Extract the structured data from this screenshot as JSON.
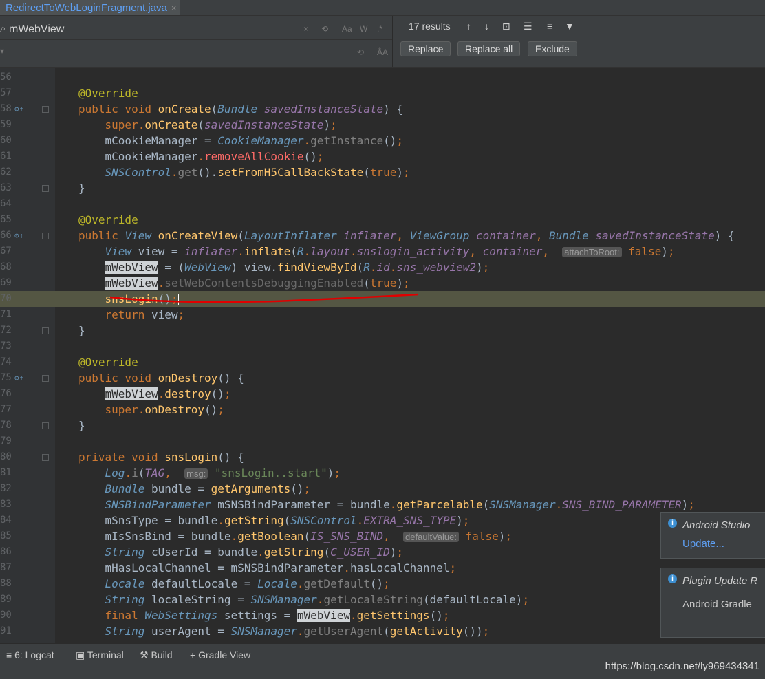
{
  "tab": {
    "label": "RedirectToWebLoginFragment.java",
    "close": "×"
  },
  "find": {
    "search_value": "mWebView",
    "options": [
      "×",
      "⟲",
      "Aa",
      "W",
      ".*"
    ],
    "replace_options": [
      "⟲",
      "ÅA"
    ],
    "results": "17 results",
    "replace_label": "Replace",
    "replace_all_label": "Replace all",
    "exclude_label": "Exclude"
  },
  "gutter": {
    "lines": [
      "56",
      "57",
      "58",
      "59",
      "60",
      "61",
      "62",
      "63",
      "64",
      "65",
      "66",
      "67",
      "68",
      "69",
      "70",
      "71",
      "72",
      "73",
      "74",
      "75",
      "76",
      "77",
      "78",
      "79",
      "80",
      "81",
      "82",
      "83",
      "84",
      "85",
      "86",
      "87",
      "88",
      "89",
      "90",
      "91"
    ]
  },
  "code": [
    [],
    [
      [
        "an",
        "@Override"
      ]
    ],
    [
      [
        "kw",
        "public void "
      ],
      [
        "fn",
        "onCreate"
      ],
      [
        "tx",
        "("
      ],
      [
        "ty",
        "Bundle "
      ],
      [
        "it",
        "savedInstanceState"
      ],
      [
        "tx",
        ") {"
      ]
    ],
    [
      [
        "tx",
        "    "
      ],
      [
        "kw",
        "super"
      ],
      [
        "pu",
        "."
      ],
      [
        "fn",
        "onCreate"
      ],
      [
        "tx",
        "("
      ],
      [
        "it",
        "savedInstanceState"
      ],
      [
        "tx",
        ")"
      ],
      [
        "pu",
        ";"
      ]
    ],
    [
      [
        "tx",
        "    mCookieManager = "
      ],
      [
        "ty",
        "CookieManager"
      ],
      [
        "pu",
        "."
      ],
      [
        "gr",
        "getInstance"
      ],
      [
        "tx",
        "()"
      ],
      [
        "pu",
        ";"
      ]
    ],
    [
      [
        "tx",
        "    mCookieManager"
      ],
      [
        "pu",
        "."
      ],
      [
        "rs",
        "removeAllCookie"
      ],
      [
        "tx",
        "()"
      ],
      [
        "pu",
        ";"
      ]
    ],
    [
      [
        "tx",
        "    "
      ],
      [
        "ty",
        "SNSControl"
      ],
      [
        "pu",
        "."
      ],
      [
        "gr",
        "get"
      ],
      [
        "tx",
        "()."
      ],
      [
        "fn",
        "setFromH5CallBackState"
      ],
      [
        "tx",
        "("
      ],
      [
        "kw",
        "true"
      ],
      [
        "tx",
        ")"
      ],
      [
        "pu",
        ";"
      ]
    ],
    [
      [
        "tx",
        "}"
      ]
    ],
    [],
    [
      [
        "an",
        "@Override"
      ]
    ],
    [
      [
        "kw",
        "public "
      ],
      [
        "ty",
        "View "
      ],
      [
        "fn",
        "onCreateView"
      ],
      [
        "tx",
        "("
      ],
      [
        "ty",
        "LayoutInflater "
      ],
      [
        "it",
        "inflater"
      ],
      [
        "pu",
        ", "
      ],
      [
        "ty",
        "ViewGroup "
      ],
      [
        "it",
        "container"
      ],
      [
        "pu",
        ", "
      ],
      [
        "ty",
        "Bundle "
      ],
      [
        "it",
        "savedInstanceState"
      ],
      [
        "tx",
        ") {"
      ]
    ],
    [
      [
        "tx",
        "    "
      ],
      [
        "ty",
        "View "
      ],
      [
        "tx",
        "view = "
      ],
      [
        "it",
        "inflater"
      ],
      [
        "pu",
        "."
      ],
      [
        "fn",
        "inflate"
      ],
      [
        "tx",
        "("
      ],
      [
        "ty",
        "R"
      ],
      [
        "pu",
        "."
      ],
      [
        "it",
        "layout"
      ],
      [
        "pu",
        "."
      ],
      [
        "it",
        "snslogin_activity"
      ],
      [
        "pu",
        ", "
      ],
      [
        "it",
        "container"
      ],
      [
        "pu",
        ",  "
      ],
      [
        "hint",
        "attachToRoot:"
      ],
      [
        "kw",
        " false"
      ],
      [
        "tx",
        ")"
      ],
      [
        "pu",
        ";"
      ]
    ],
    [
      [
        "tx",
        "    "
      ],
      [
        "hl",
        "mWebView"
      ],
      [
        "tx",
        " = ("
      ],
      [
        "ty",
        "WebView"
      ],
      [
        "tx",
        ") view."
      ],
      [
        "fn",
        "findViewById"
      ],
      [
        "tx",
        "("
      ],
      [
        "ty",
        "R"
      ],
      [
        "pu",
        "."
      ],
      [
        "it",
        "id"
      ],
      [
        "pu",
        "."
      ],
      [
        "it",
        "sns_webview2"
      ],
      [
        "tx",
        ")"
      ],
      [
        "pu",
        ";"
      ]
    ],
    [
      [
        "tx",
        "    "
      ],
      [
        "hl",
        "mWebView"
      ],
      [
        "pu",
        "."
      ],
      [
        "ex",
        "setWebContentsDebuggingEnabled"
      ],
      [
        "tx",
        "("
      ],
      [
        "kw",
        "true"
      ],
      [
        "tx",
        ")"
      ],
      [
        "pu",
        ";"
      ]
    ],
    [
      [
        "tx",
        "    "
      ],
      [
        "fn",
        "snsLogin"
      ],
      [
        "tx",
        "()"
      ],
      [
        "pu",
        ";"
      ]
    ],
    [
      [
        "tx",
        "    "
      ],
      [
        "kw",
        "return "
      ],
      [
        "tx",
        "view"
      ],
      [
        "pu",
        ";"
      ]
    ],
    [
      [
        "tx",
        "}"
      ]
    ],
    [],
    [
      [
        "an",
        "@Override"
      ]
    ],
    [
      [
        "kw",
        "public void "
      ],
      [
        "fn",
        "onDestroy"
      ],
      [
        "tx",
        "() {"
      ]
    ],
    [
      [
        "tx",
        "    "
      ],
      [
        "hl",
        "mWebView"
      ],
      [
        "pu",
        "."
      ],
      [
        "fn",
        "destroy"
      ],
      [
        "tx",
        "()"
      ],
      [
        "pu",
        ";"
      ]
    ],
    [
      [
        "tx",
        "    "
      ],
      [
        "kw",
        "super"
      ],
      [
        "pu",
        "."
      ],
      [
        "fn",
        "onDestroy"
      ],
      [
        "tx",
        "()"
      ],
      [
        "pu",
        ";"
      ]
    ],
    [
      [
        "tx",
        "}"
      ]
    ],
    [],
    [
      [
        "kw",
        "private void "
      ],
      [
        "fn",
        "snsLogin"
      ],
      [
        "tx",
        "() {"
      ]
    ],
    [
      [
        "tx",
        "    "
      ],
      [
        "ty",
        "Log"
      ],
      [
        "pu",
        "."
      ],
      [
        "gr",
        "i"
      ],
      [
        "tx",
        "("
      ],
      [
        "it",
        "TAG"
      ],
      [
        "pu",
        ",  "
      ],
      [
        "hint",
        "msg:"
      ],
      [
        "st",
        " \"snsLogin..start\""
      ],
      [
        "tx",
        ")"
      ],
      [
        "pu",
        ";"
      ]
    ],
    [
      [
        "tx",
        "    "
      ],
      [
        "ty",
        "Bundle "
      ],
      [
        "tx",
        "bundle = "
      ],
      [
        "fn",
        "getArguments"
      ],
      [
        "tx",
        "()"
      ],
      [
        "pu",
        ";"
      ]
    ],
    [
      [
        "tx",
        "    "
      ],
      [
        "ty",
        "SNSBindParameter "
      ],
      [
        "tx",
        "mSNSBindParameter = bundle"
      ],
      [
        "pu",
        "."
      ],
      [
        "fn",
        "getParcelable"
      ],
      [
        "tx",
        "("
      ],
      [
        "ty",
        "SNSManager"
      ],
      [
        "pu",
        "."
      ],
      [
        "it",
        "SNS_BIND_PARAMETER"
      ],
      [
        "tx",
        ")"
      ],
      [
        "pu",
        ";"
      ]
    ],
    [
      [
        "tx",
        "    mSnsType = bundle"
      ],
      [
        "pu",
        "."
      ],
      [
        "fn",
        "getString"
      ],
      [
        "tx",
        "("
      ],
      [
        "ty",
        "SNSControl"
      ],
      [
        "pu",
        "."
      ],
      [
        "it",
        "EXTRA_SNS_TYPE"
      ],
      [
        "tx",
        ")"
      ],
      [
        "pu",
        ";"
      ]
    ],
    [
      [
        "tx",
        "    mIsSnsBind = bundle"
      ],
      [
        "pu",
        "."
      ],
      [
        "fn",
        "getBoolean"
      ],
      [
        "tx",
        "("
      ],
      [
        "it",
        "IS_SNS_BIND"
      ],
      [
        "pu",
        ",  "
      ],
      [
        "hint",
        "defaultValue:"
      ],
      [
        "kw",
        " false"
      ],
      [
        "tx",
        ")"
      ],
      [
        "pu",
        ";"
      ]
    ],
    [
      [
        "tx",
        "    "
      ],
      [
        "ty",
        "String "
      ],
      [
        "tx",
        "cUserId = bundle"
      ],
      [
        "pu",
        "."
      ],
      [
        "fn",
        "getString"
      ],
      [
        "tx",
        "("
      ],
      [
        "it",
        "C_USER_ID"
      ],
      [
        "tx",
        ")"
      ],
      [
        "pu",
        ";"
      ]
    ],
    [
      [
        "tx",
        "    mHasLocalChannel = mSNSBindParameter"
      ],
      [
        "pu",
        "."
      ],
      [
        "tx",
        "hasLocalChannel"
      ],
      [
        "pu",
        ";"
      ]
    ],
    [
      [
        "tx",
        "    "
      ],
      [
        "ty",
        "Locale "
      ],
      [
        "tx",
        "defaultLocale = "
      ],
      [
        "ty",
        "Locale"
      ],
      [
        "pu",
        "."
      ],
      [
        "gr",
        "getDefault"
      ],
      [
        "tx",
        "()"
      ],
      [
        "pu",
        ";"
      ]
    ],
    [
      [
        "tx",
        "    "
      ],
      [
        "ty",
        "String "
      ],
      [
        "tx",
        "localeString = "
      ],
      [
        "ty",
        "SNSManager"
      ],
      [
        "pu",
        "."
      ],
      [
        "gr",
        "getLocaleString"
      ],
      [
        "tx",
        "(defaultLocale)"
      ],
      [
        "pu",
        ";"
      ]
    ],
    [
      [
        "tx",
        "    "
      ],
      [
        "kw",
        "final "
      ],
      [
        "ty",
        "WebSettings "
      ],
      [
        "tx",
        "settings = "
      ],
      [
        "hl",
        "mWebView"
      ],
      [
        "pu",
        "."
      ],
      [
        "fn",
        "getSettings"
      ],
      [
        "tx",
        "()"
      ],
      [
        "pu",
        ";"
      ]
    ],
    [
      [
        "tx",
        "    "
      ],
      [
        "ty",
        "String "
      ],
      [
        "tx",
        "userAgent = "
      ],
      [
        "ty",
        "SNSManager"
      ],
      [
        "pu",
        "."
      ],
      [
        "gr",
        "getUserAgent"
      ],
      [
        "tx",
        "("
      ],
      [
        "fn",
        "getActivity"
      ],
      [
        "tx",
        "())"
      ],
      [
        "pu",
        ";"
      ]
    ]
  ],
  "notifications": [
    {
      "title": "Android Studio",
      "body": "Update..."
    },
    {
      "title": "Plugin Update R",
      "body": "Android Gradle"
    }
  ],
  "toolwindows": {
    "logcat_label": "6: Logcat",
    "terminal_label": "Terminal",
    "build_label": "Build",
    "gradle_label": "Gradle View"
  },
  "status": {
    "url": "https://blog.csdn.net/ly969434341"
  },
  "colors": {
    "accent": "#5e9ff2",
    "background": "#2b2b2b",
    "caret_line": "#545643",
    "squiggle": "#e00000"
  }
}
